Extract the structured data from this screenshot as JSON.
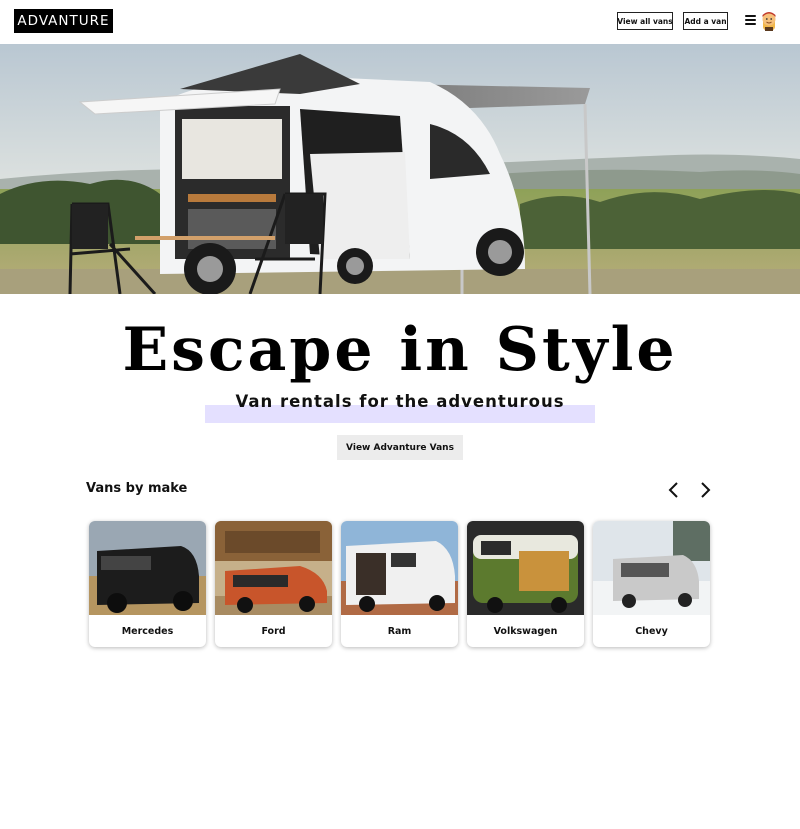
{
  "header": {
    "logo": "ADVANTURE",
    "view_all_label": "View all vans",
    "add_van_label": "Add a van"
  },
  "hero": {
    "headline": "Escape in Style",
    "subheadline": "Van rentals for the adventurous",
    "cta_label": "View Advanture Vans"
  },
  "makes": {
    "title": "Vans by make",
    "items": [
      {
        "label": "Mercedes"
      },
      {
        "label": "Ford"
      },
      {
        "label": "Ram"
      },
      {
        "label": "Volkswagen"
      },
      {
        "label": "Chevy"
      }
    ]
  },
  "icons": {
    "menu": "hamburger-icon",
    "avatar": "avatar-icon",
    "prev": "chevron-left-icon",
    "next": "chevron-right-icon"
  },
  "colors": {
    "logo_bg": "#000000",
    "highlight": "#e4e0ff",
    "cta_bg": "#ececec"
  }
}
